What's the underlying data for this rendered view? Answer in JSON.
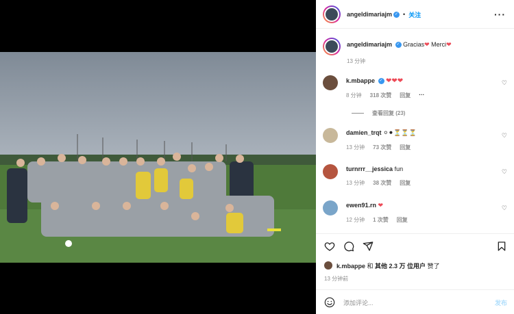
{
  "header": {
    "username": "angeldimariajm",
    "follow_label": "关注",
    "more_icon": "more-horizontal-icon"
  },
  "caption": {
    "username": "angeldimariajm",
    "text_part1": "Gracias",
    "text_part2": "Merci",
    "time": "13 分钟"
  },
  "comments": [
    {
      "username": "k.mbappe",
      "verified": true,
      "text": "❤❤❤",
      "time": "8 分钟",
      "likes": "318 次赞",
      "reply": "回复",
      "more": "···",
      "view_replies": "查看回复 (23)",
      "avatar_color": "#6b4e3d"
    },
    {
      "username": "damien_trqt",
      "text": "⚪⚫⏳⏳⏳",
      "time": "13 分钟",
      "likes": "73 次赞",
      "reply": "回复",
      "avatar_color": "#c8b89a"
    },
    {
      "username": "turnrrr__jessica",
      "text": "fun",
      "time": "13 分钟",
      "likes": "38 次赞",
      "reply": "回复",
      "avatar_color": "#b5553f"
    },
    {
      "username": "ewen91.rn",
      "text": "❤",
      "time": "12 分钟",
      "likes": "1 次赞",
      "reply": "回复",
      "avatar_color": "#7aa5c9"
    }
  ],
  "actions": {
    "like_icon": "heart-icon",
    "comment_icon": "comment-icon",
    "share_icon": "send-icon",
    "save_icon": "bookmark-icon"
  },
  "likes_line": {
    "user": "k.mbappe",
    "mid": " 和 ",
    "others": "其他 2.3 万 位用户",
    "end": " 赞了"
  },
  "post_time": "13 分钟前",
  "add_comment": {
    "emoji_icon": "smiley-icon",
    "placeholder": "添加评论...",
    "post_label": "发布"
  },
  "colors": {
    "accent": "#0095f6",
    "verified": "#3897f0",
    "heart_red": "#ed4956"
  }
}
